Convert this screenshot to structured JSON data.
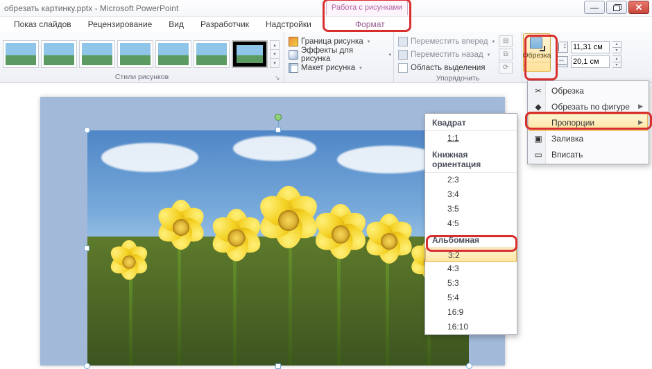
{
  "title": {
    "doc": "обрезать картинку.pptx",
    "app": "Microsoft PowerPoint",
    "tool_tab": "Работа с рисунками"
  },
  "tabs": {
    "t1": "Показ слайдов",
    "t2": "Рецензирование",
    "t3": "Вид",
    "t4": "Разработчик",
    "t5": "Надстройки",
    "format": "Формат"
  },
  "ribbon": {
    "styles_label": "Стили рисунков",
    "arrange_label": "Упорядочить",
    "border": "Граница рисунка",
    "effects": "Эффекты для рисунка",
    "layout": "Макет рисунка",
    "bring_forward": "Переместить вперед",
    "send_backward": "Переместить назад",
    "selection_pane": "Область выделения",
    "crop_label": "Обрезка",
    "size": {
      "h": "11,31 см",
      "w": "20,1 см"
    }
  },
  "crop_menu": {
    "crop": "Обрезка",
    "shape": "Обрезать по фигуре",
    "aspect": "Пропорции",
    "fill": "Заливка",
    "fit": "Вписать"
  },
  "ratio": {
    "square": "Квадрат",
    "r11": "1:1",
    "portrait": "Книжная ориентация",
    "r23": "2:3",
    "r34": "3:4",
    "r35": "3:5",
    "r45": "4:5",
    "landscape": "Альбомная",
    "r32": "3:2",
    "r43": "4:3",
    "r53": "5:3",
    "r54": "5:4",
    "r169": "16:9",
    "r1610": "16:10"
  }
}
